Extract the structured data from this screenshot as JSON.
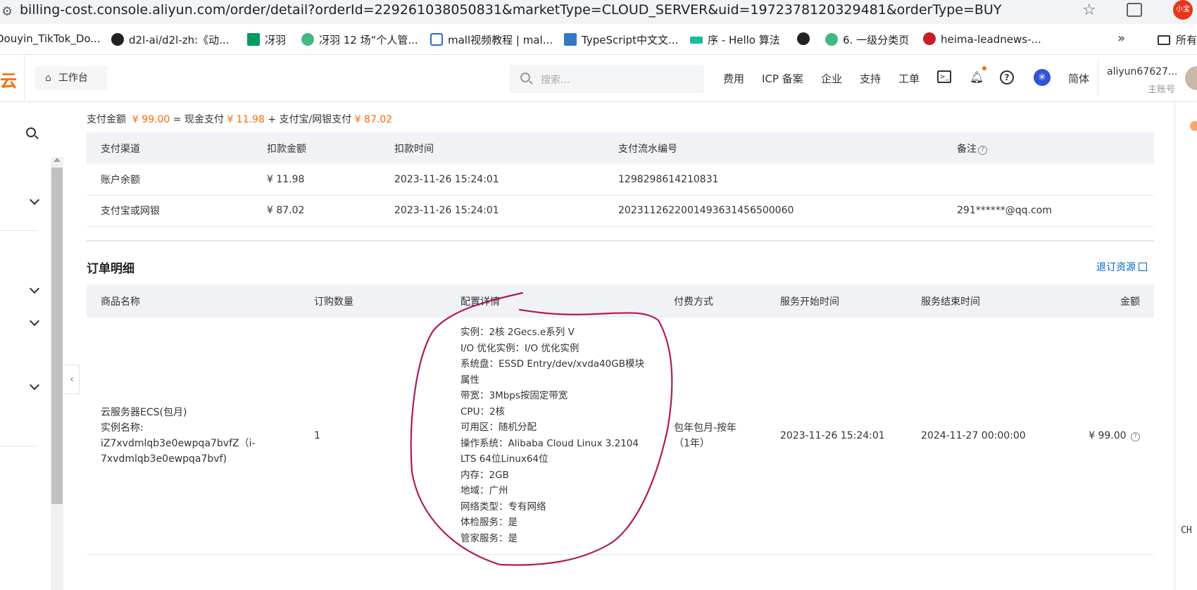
{
  "browser": {
    "url": "billing-cost.console.aliyun.com/order/detail?orderId=229261038050831&marketType=CLOUD_SERVER&uid=1972378120329481&orderType=BUY",
    "profile_label": "小宝",
    "bookmarks": [
      {
        "label": "Douyin_TikTok_Do...",
        "icon": "bookmark-icon"
      },
      {
        "label": "d2l-ai/d2l-zh:《动...",
        "icon": "github-icon"
      },
      {
        "label": "冴羽",
        "icon": "segmentfault-icon"
      },
      {
        "label": "冴羽 12 场“个人管...",
        "icon": "leaf-icon"
      },
      {
        "label": "mall视频教程 | mal...",
        "icon": "store-icon"
      },
      {
        "label": "TypeScript中文文...",
        "icon": "typescript-icon"
      },
      {
        "label": "序 - Hello 算法",
        "icon": "hello-algo-icon"
      },
      {
        "label": "",
        "icon": "github-icon"
      },
      {
        "label": "6. 一级分类页",
        "icon": "leaf-icon"
      },
      {
        "label": "heima-leadnews-...",
        "icon": "gitee-icon"
      }
    ],
    "more_label": "»",
    "all_bookmarks_label": "所有书签"
  },
  "header": {
    "logo_text": "云",
    "workbench_label": "工作台",
    "search_placeholder": "搜索...",
    "nav": [
      "费用",
      "ICP 备案",
      "企业",
      "支持",
      "工单"
    ],
    "lang_label": "简体",
    "user_name": "aliyun67627...",
    "user_role": "主账号"
  },
  "payment": {
    "summary_prefix": "支付金额",
    "total": "¥ 99.00",
    "eq": "=",
    "cash_label": "现金支付",
    "cash": "¥ 11.98",
    "plus": "+",
    "alipay_label": "支付宝/网银支付",
    "alipay": "¥ 87.02",
    "columns": [
      "支付渠道",
      "扣款金额",
      "扣款时间",
      "支付流水编号",
      "备注"
    ],
    "rows": [
      {
        "channel": "账户余额",
        "amount": "¥ 11.98",
        "time": "2023-11-26 15:24:01",
        "serial": "1298298614210831",
        "note": ""
      },
      {
        "channel": "支付宝或网银",
        "amount": "¥ 87.02",
        "time": "2023-11-26 15:24:01",
        "serial": "2023112622001493631456500060",
        "note": "291******@qq.com"
      }
    ]
  },
  "order_detail": {
    "title": "订单明细",
    "refund_link": "退订资源",
    "columns": [
      "商品名称",
      "订购数量",
      "配置详情",
      "付费方式",
      "服务开始时间",
      "服务结束时间",
      "金额"
    ],
    "row": {
      "product_line1": "云服务器ECS(包月)",
      "product_line2": "实例名称:",
      "product_line3": "iZ7xvdmlqb3e0ewpqa7bvfZ（i-",
      "product_line4": "7xvdmlqb3e0ewpqa7bvf)",
      "quantity": "1",
      "config": [
        "实例：2核 2Gecs.e系列 V",
        "I/O 优化实例：I/O 优化实例",
        "系统盘：ESSD Entry/dev/xvda40GB模块",
        "属性",
        "带宽：3Mbps按固定带宽",
        "CPU：2核",
        "可用区：随机分配",
        "操作系统：Alibaba Cloud Linux 3.2104",
        "LTS 64位Linux64位",
        "内存：2GB",
        "地域：广州",
        "网络类型：专有网络",
        "体检服务：是",
        "管家服务：是"
      ],
      "billing_line1": "包年包月-按年",
      "billing_line2": "（1年）",
      "start": "2023-11-26 15:24:01",
      "end": "2024-11-27 00:00:00",
      "amount": "¥ 99.00"
    }
  },
  "ime_label": "CH",
  "annotation_color": "#b0195d"
}
